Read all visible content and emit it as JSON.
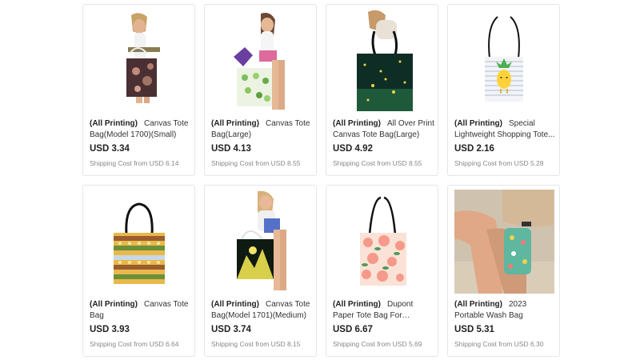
{
  "products": [
    {
      "tag": "(All Printing)",
      "name": "Canvas Tote Bag(Model 1700)(Small)",
      "price": "USD 3.34",
      "shipping": "Shipping Cost from USD 6.14",
      "image": "woman-small-tote"
    },
    {
      "tag": "(All Printing)",
      "name": "Canvas Tote Bag(Large)",
      "price": "USD 4.13",
      "shipping": "Shipping Cost from USD 8.55",
      "image": "woman-large-tote"
    },
    {
      "tag": "(All Printing)",
      "name": "All Over Print Canvas Tote Bag(Large)",
      "price": "USD 4.92",
      "shipping": "Shipping Cost from USD 8.55",
      "image": "woman-dark-tote"
    },
    {
      "tag": "(All Printing)",
      "name": "Special Lightweight Shopping Tote...",
      "price": "USD 2.16",
      "shipping": "Shipping Cost from USD 5.28",
      "image": "pineapple-tote"
    },
    {
      "tag": "(All Printing)",
      "name": "Canvas Tote Bag",
      "price": "USD 3.93",
      "shipping": "Shipping Cost from USD 6.64",
      "image": "pattern-tote"
    },
    {
      "tag": "(All Printing)",
      "name": "Canvas Tote Bag(Model 1701)(Medium)",
      "price": "USD 3.74",
      "shipping": "Shipping Cost from USD 8.15",
      "image": "woman-medium-tote"
    },
    {
      "tag": "(All Printing)",
      "name": "Dupont Paper Tote Bag For Vegetables",
      "price": "USD 6.67",
      "shipping": "Shipping Cost from USD 5.69",
      "image": "peach-tote"
    },
    {
      "tag": "(All Printing)",
      "name": "2023 Portable Wash Bag",
      "price": "USD 5.31",
      "shipping": "Shipping Cost from USD 6.30",
      "image": "wash-bag"
    }
  ]
}
